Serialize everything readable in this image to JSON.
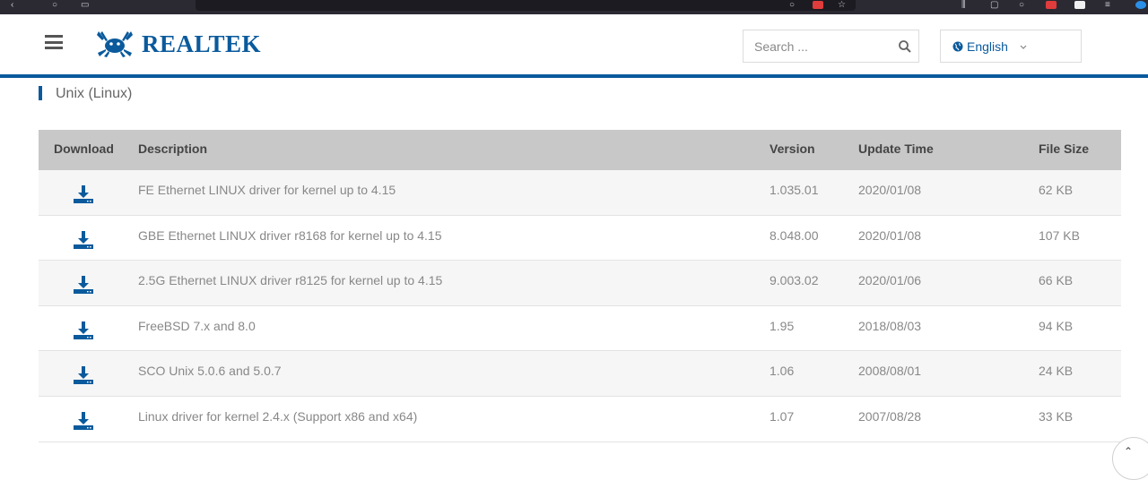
{
  "header": {
    "logo_text": "REALTEK",
    "search_placeholder": "Search ...",
    "language": "English"
  },
  "section": {
    "title": "Unix (Linux)"
  },
  "table": {
    "columns": [
      "Download",
      "Description",
      "Version",
      "Update Time",
      "File Size"
    ],
    "rows": [
      {
        "description": "FE Ethernet LINUX driver for kernel up to 4.15",
        "version": "1.035.01",
        "update_time": "2020/01/08",
        "file_size": "62 KB"
      },
      {
        "description": "GBE Ethernet LINUX driver r8168 for kernel up to 4.15",
        "version": "8.048.00",
        "update_time": "2020/01/08",
        "file_size": "107 KB"
      },
      {
        "description": "2.5G Ethernet LINUX driver r8125 for kernel up to 4.15",
        "version": "9.003.02",
        "update_time": "2020/01/06",
        "file_size": "66 KB"
      },
      {
        "description": "FreeBSD 7.x and 8.0",
        "version": "1.95",
        "update_time": "2018/08/03",
        "file_size": "94 KB"
      },
      {
        "description": "SCO Unix 5.0.6 and 5.0.7",
        "version": "1.06",
        "update_time": "2008/08/01",
        "file_size": "24 KB"
      },
      {
        "description": "Linux driver for kernel 2.4.x (Support x86 and x64)",
        "version": "1.07",
        "update_time": "2007/08/28",
        "file_size": "33 KB"
      }
    ]
  },
  "icons": {
    "menu": "hamburger-menu-icon",
    "logo": "realtek-crab-logo",
    "search": "search-icon",
    "globe": "globe-icon",
    "chevron": "chevron-down-icon",
    "download": "download-icon",
    "scroll": "scroll-top-icon"
  },
  "colors": {
    "brand": "#0a5a9c",
    "table_header": "#c8c8c8",
    "row_alt": "#f6f6f6",
    "muted_text": "#888888"
  }
}
